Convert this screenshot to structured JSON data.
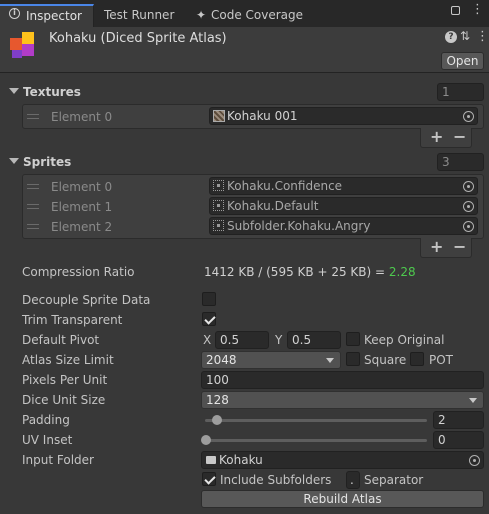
{
  "tabs": [
    {
      "label": "Inspector",
      "icon": "info-icon",
      "active": true
    },
    {
      "label": "Test Runner"
    },
    {
      "label": "Code Coverage",
      "icon": "coverage-icon"
    }
  ],
  "header": {
    "title": "Kohaku (Diced Sprite Atlas)",
    "open_label": "Open"
  },
  "textures": {
    "label": "Textures",
    "count": "1",
    "elements": [
      {
        "label": "Element 0",
        "value": "Kohaku 001"
      }
    ]
  },
  "sprites": {
    "label": "Sprites",
    "count": "3",
    "elements": [
      {
        "label": "Element 0",
        "value": "Kohaku.Confidence"
      },
      {
        "label": "Element 1",
        "value": "Kohaku.Default"
      },
      {
        "label": "Element 2",
        "value": "Subfolder.Kohaku.Angry"
      }
    ]
  },
  "compression": {
    "label": "Compression Ratio",
    "text": "1412 KB / (595 KB + 25 KB) = ",
    "ratio": "2.28",
    "ratio_color": "#4ec94e"
  },
  "decouple": {
    "label": "Decouple Sprite Data",
    "checked": false
  },
  "trim": {
    "label": "Trim Transparent",
    "checked": true
  },
  "pivot": {
    "label": "Default Pivot",
    "x_label": "X",
    "x": "0.5",
    "y_label": "Y",
    "y": "0.5",
    "keep_label": "Keep Original",
    "keep_checked": false
  },
  "atlas_size": {
    "label": "Atlas Size Limit",
    "value": "2048",
    "square_label": "Square",
    "square_checked": false,
    "pot_label": "POT",
    "pot_checked": false
  },
  "ppu": {
    "label": "Pixels Per Unit",
    "value": "100"
  },
  "dice_unit": {
    "label": "Dice Unit Size",
    "value": "128"
  },
  "padding": {
    "label": "Padding",
    "value": "2",
    "slider_fraction": 0.05
  },
  "uv_inset": {
    "label": "UV Inset",
    "value": "0",
    "slider_fraction": 0.0
  },
  "input_folder": {
    "label": "Input Folder",
    "value": "Kohaku"
  },
  "include_subfolders": {
    "label": "Include Subfolders",
    "checked": true
  },
  "separator": {
    "label": "Separator",
    "value": "."
  },
  "rebuild_label": "Rebuild Atlas"
}
